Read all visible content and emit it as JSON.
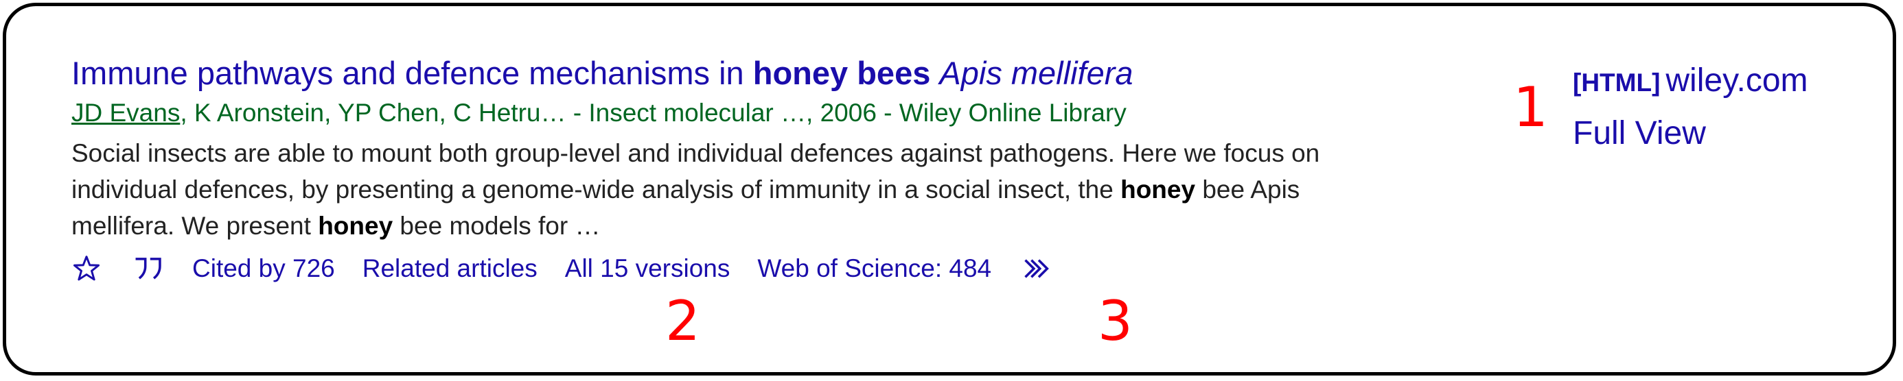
{
  "result": {
    "title_parts": {
      "plain": "Immune pathways and defence mechanisms in ",
      "bold": "honey bees",
      "italic": "Apis mellifera"
    },
    "byline": {
      "first_author": "JD Evans",
      "rest": ", K Aronstein, YP Chen, C Hetru… - Insect molecular …, 2006 - Wiley Online Library"
    },
    "snippet": {
      "part1": "Social insects are able to mount both group-level and individual defences against pathogens. Here we focus on individual defences, by presenting a genome-wide analysis of immunity in a social insect, the ",
      "bold1": "honey",
      "part2": " bee Apis mellifera. We present ",
      "bold2": "honey",
      "part3": " bee models for …"
    },
    "actions": {
      "cited_by": "Cited by 726",
      "related": "Related articles",
      "versions": "All 15 versions",
      "wos": "Web of Science: 484"
    },
    "side": {
      "format": "[HTML]",
      "domain": "wiley.com",
      "full_view": "Full View"
    }
  },
  "markers": [
    "1",
    "2",
    "3"
  ],
  "icons": {
    "save": "star-icon",
    "cite": "quote-icon",
    "more": "double-chevron-icon"
  },
  "colors": {
    "link": "#1a0dab",
    "byline": "#006621",
    "snippet": "#222222",
    "marker": "#ff0000"
  }
}
